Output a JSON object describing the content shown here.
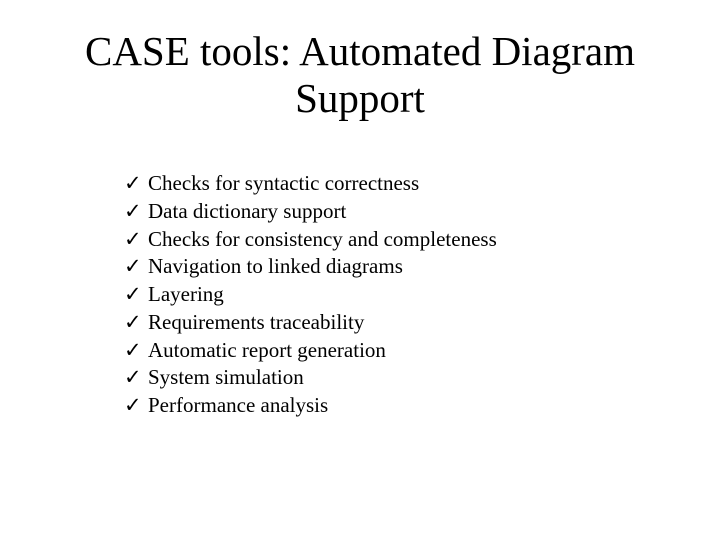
{
  "title": "CASE tools: Automated Diagram Support",
  "check_glyph": "✓",
  "bullets": [
    "Checks for syntactic correctness",
    "Data dictionary support",
    "Checks for consistency and completeness",
    "Navigation to linked diagrams",
    "Layering",
    "Requirements traceability",
    "Automatic report generation",
    "System simulation",
    "Performance analysis"
  ]
}
